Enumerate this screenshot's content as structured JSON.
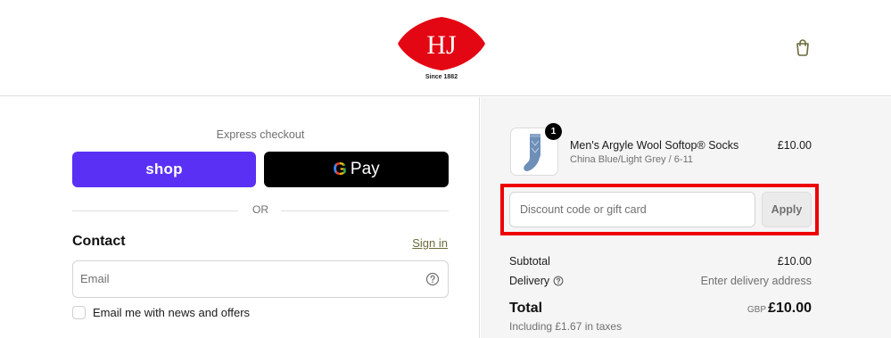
{
  "brand": {
    "logo_text": "HJ",
    "logo_tagline": "Since 1882",
    "logo_color": "#e30613",
    "icon": "shopping-bag-icon"
  },
  "express": {
    "label": "Express checkout",
    "shop_label": "shop",
    "gpay_g": "G",
    "gpay_label": "Pay",
    "shop_color": "#5a31f4",
    "gpay_color": "#000000",
    "divider_text": "OR"
  },
  "contact": {
    "title": "Contact",
    "sign_in": "Sign in",
    "email_placeholder": "Email",
    "email_help_icon": "question-circle-icon",
    "newsletter_label": "Email me with news and offers",
    "newsletter_checked": false
  },
  "order": {
    "item": {
      "name": "Men's Argyle Wool Softop® Socks",
      "variant": "China Blue/Light Grey / 6-11",
      "price": "£10.00",
      "quantity": "1",
      "image_icon": "socks-image"
    },
    "discount": {
      "placeholder": "Discount code or gift card",
      "apply_label": "Apply",
      "highlight_color": "#ee0000"
    },
    "subtotal_label": "Subtotal",
    "subtotal_value": "£10.00",
    "delivery_label": "Delivery",
    "delivery_value": "Enter delivery address",
    "total_label": "Total",
    "total_currency": "GBP",
    "total_value": "£10.00",
    "tax_note": "Including £1.67 in taxes"
  }
}
